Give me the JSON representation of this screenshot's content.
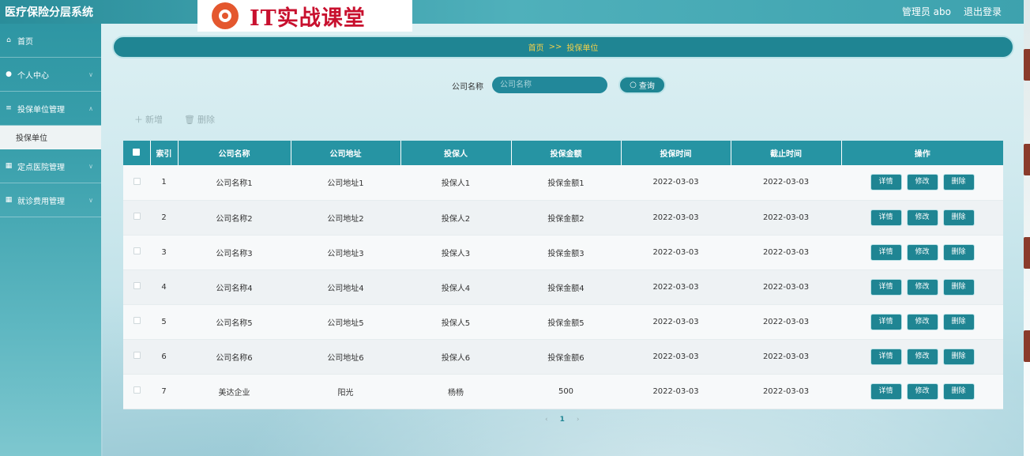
{
  "app": {
    "title": "医疗保险分层系统",
    "logo_text": "IT实战课堂"
  },
  "header": {
    "user": "管理员 abo",
    "logout": "退出登录"
  },
  "sidebar": {
    "items": [
      {
        "label": "首页",
        "icon": "home-icon"
      },
      {
        "label": "个人中心",
        "icon": "user-icon"
      },
      {
        "label": "投保单位管理",
        "icon": "list-icon"
      },
      {
        "label": "投保单位"
      },
      {
        "label": "定点医院管理",
        "icon": "calendar-icon"
      },
      {
        "label": "就诊费用管理",
        "icon": "calendar-icon"
      }
    ]
  },
  "breadcrumb": {
    "home": "首页",
    "sep": ">>",
    "current": "投保单位"
  },
  "search": {
    "label": "公司名称",
    "placeholder": "公司名称",
    "button": "查询"
  },
  "actions": {
    "add": "新增",
    "delete": "删除"
  },
  "table": {
    "columns": [
      "索引",
      "公司名称",
      "公司地址",
      "投保人",
      "投保金额",
      "投保时间",
      "截止时间",
      "操作"
    ],
    "rows": [
      {
        "index": "1",
        "company": "公司名称1",
        "address": "公司地址1",
        "insurer": "投保人1",
        "amount": "投保金额1",
        "start": "2022-03-03",
        "end": "2022-03-03"
      },
      {
        "index": "2",
        "company": "公司名称2",
        "address": "公司地址2",
        "insurer": "投保人2",
        "amount": "投保金额2",
        "start": "2022-03-03",
        "end": "2022-03-03"
      },
      {
        "index": "3",
        "company": "公司名称3",
        "address": "公司地址3",
        "insurer": "投保人3",
        "amount": "投保金额3",
        "start": "2022-03-03",
        "end": "2022-03-03"
      },
      {
        "index": "4",
        "company": "公司名称4",
        "address": "公司地址4",
        "insurer": "投保人4",
        "amount": "投保金额4",
        "start": "2022-03-03",
        "end": "2022-03-03"
      },
      {
        "index": "5",
        "company": "公司名称5",
        "address": "公司地址5",
        "insurer": "投保人5",
        "amount": "投保金额5",
        "start": "2022-03-03",
        "end": "2022-03-03"
      },
      {
        "index": "6",
        "company": "公司名称6",
        "address": "公司地址6",
        "insurer": "投保人6",
        "amount": "投保金额6",
        "start": "2022-03-03",
        "end": "2022-03-03"
      },
      {
        "index": "7",
        "company": "美达企业",
        "address": "阳光",
        "insurer": "杨杨",
        "amount": "500",
        "start": "2022-03-03",
        "end": "2022-03-03"
      }
    ],
    "row_actions": {
      "detail": "详情",
      "edit": "修改",
      "delete": "删除"
    }
  },
  "pagination": {
    "prev": "‹",
    "current": "1",
    "next": "›"
  },
  "colors": {
    "primary": "#1f8593",
    "header": "#2694a3",
    "accent_text": "#f2d04a"
  }
}
